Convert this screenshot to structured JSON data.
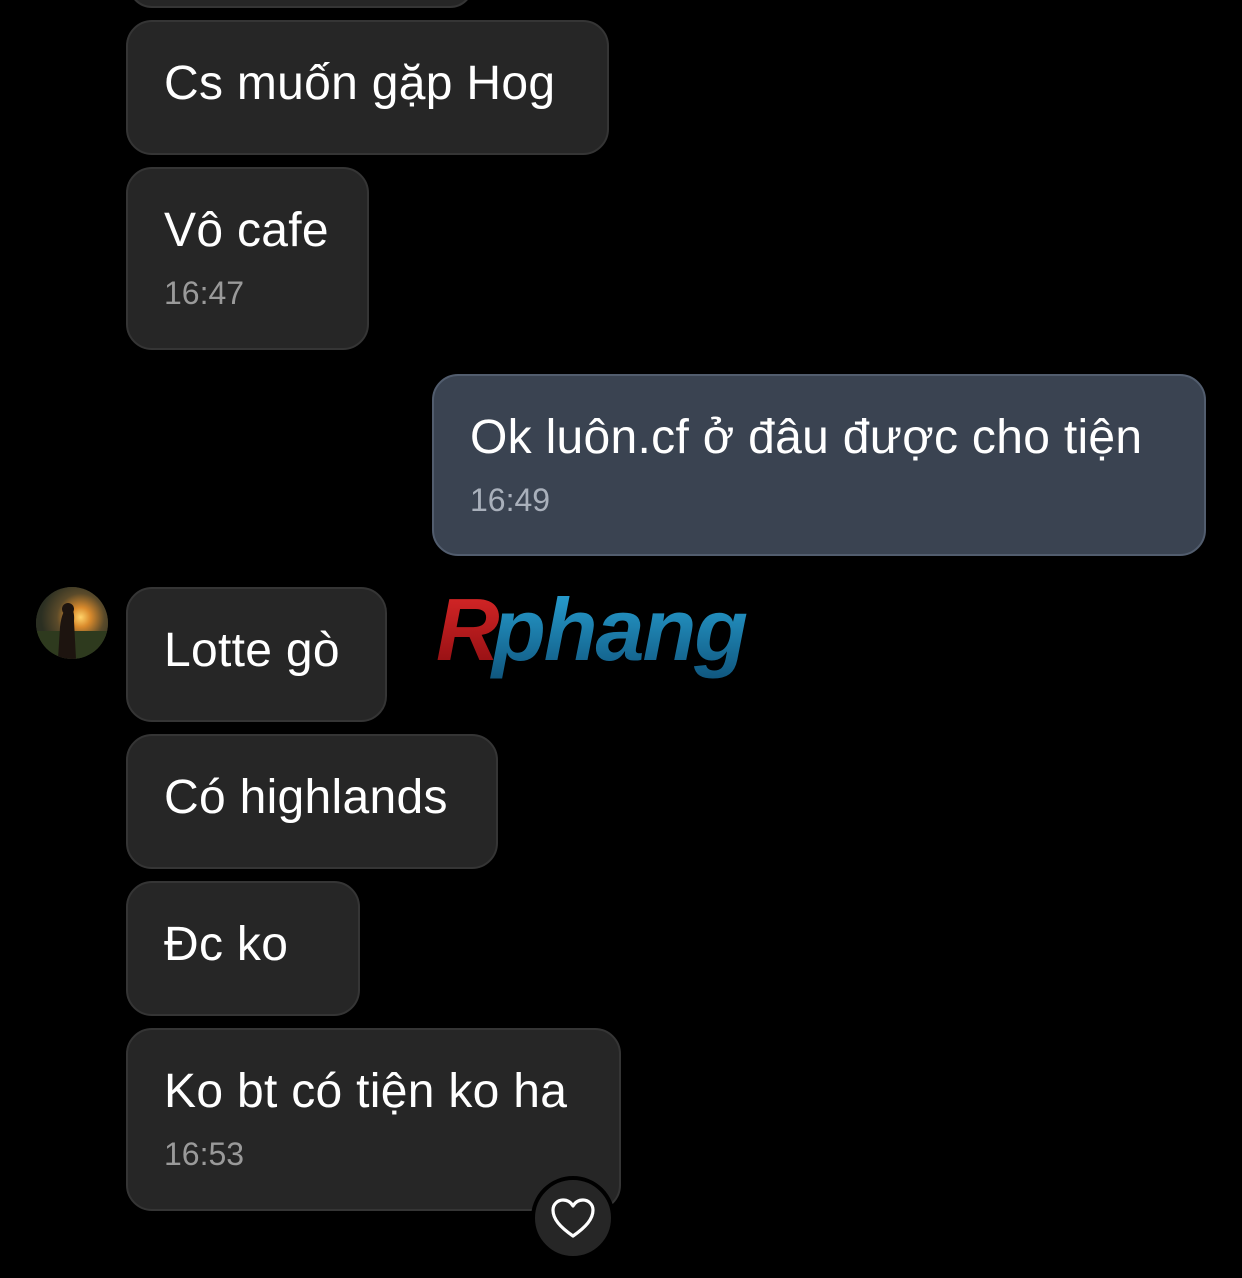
{
  "messages": [
    {
      "id": "m1",
      "text": "Cs muốn gặp Hog",
      "time": "",
      "mine": false
    },
    {
      "id": "m2",
      "text": "Vô cafe",
      "time": "16:47",
      "mine": false
    },
    {
      "id": "m3",
      "text": "Ok luôn.cf ở đâu được cho tiện",
      "time": "16:49",
      "mine": true
    },
    {
      "id": "m4",
      "text": "Lotte gò",
      "time": "",
      "mine": false
    },
    {
      "id": "m5",
      "text": "Có highlands",
      "time": "",
      "mine": false
    },
    {
      "id": "m6",
      "text": "Đc ko",
      "time": "",
      "mine": false
    },
    {
      "id": "m7",
      "text": "Ko bt có tiện ko ha",
      "time": "16:53",
      "mine": false
    }
  ],
  "watermark": {
    "text": "Rphang"
  },
  "icons": {
    "avatar": "contact-avatar-photo",
    "reaction": "heart-icon"
  },
  "colors": {
    "background": "#000000",
    "incoming_bubble": "#262626",
    "outgoing_bubble": "#3a4351",
    "timestamp": "#9a9a9a",
    "watermark_red": "#c4161c",
    "watermark_blue": "#1b7fb0"
  }
}
